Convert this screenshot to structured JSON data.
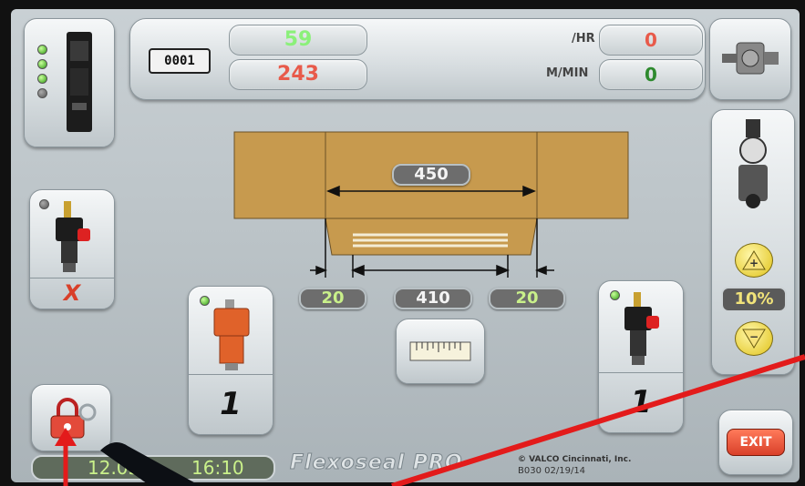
{
  "counters": {
    "id_display": "0001",
    "top_value": "59",
    "bottom_value": "243",
    "rate_label": "/HR",
    "rate_value": "0",
    "speed_label": "M/MIN",
    "speed_value": "0"
  },
  "diagram": {
    "total_length": "450",
    "left_margin": "20",
    "center_length": "410",
    "right_margin": "20"
  },
  "left_valve": {
    "status_mark": "X"
  },
  "gun_left": {
    "count": "1"
  },
  "gun_right": {
    "count": "1"
  },
  "pressure": {
    "percent": "10%"
  },
  "exit_label": "EXIT",
  "footer": {
    "date": "12.05",
    "time": "16:10",
    "brand": "Flexoseal PRO",
    "copyright": "© VALCO Cincinnati, Inc.",
    "version": "B030 02/19/14"
  },
  "colors": {
    "green_value": "#8bf07a",
    "red_value": "#e85a4a",
    "carton": "#c79a4e",
    "exit_button": "#d9402a",
    "arrow_annotation": "#e31b1b"
  },
  "icons": {
    "controller": "controller-icon",
    "motor": "motor-icon",
    "valve": "valve-icon",
    "regulator": "regulator-icon",
    "glue_gun": "glue-gun-icon",
    "ruler": "ruler-icon",
    "lock": "lock-icon"
  }
}
